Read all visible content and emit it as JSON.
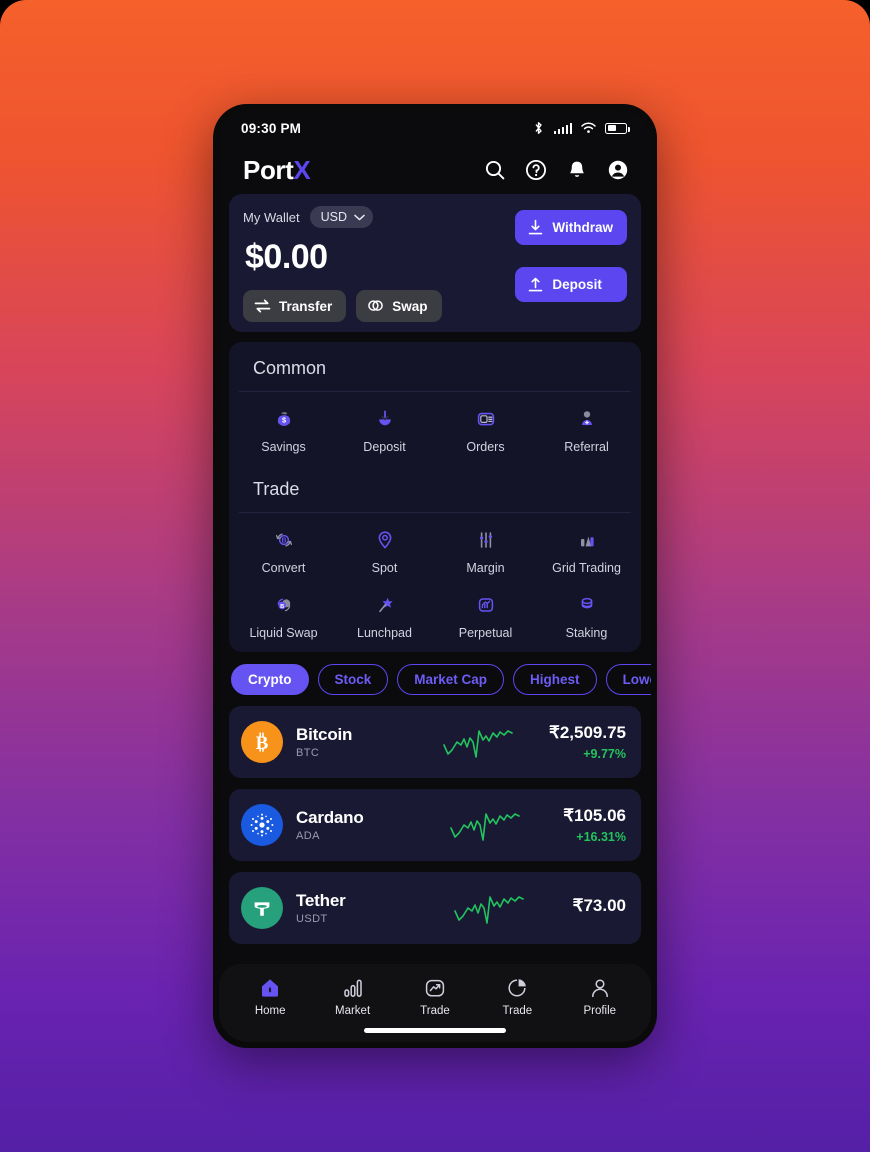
{
  "status_bar": {
    "time": "09:30 PM",
    "icons": [
      "bluetooth-icon",
      "signal-icon",
      "wifi-icon",
      "battery-icon"
    ]
  },
  "header": {
    "brand_first": "Port",
    "brand_accent": "X",
    "icons": [
      "search-icon",
      "help-icon",
      "notification-icon",
      "account-icon"
    ]
  },
  "wallet": {
    "label": "My Wallet",
    "currency": "USD",
    "balance": "$0.00",
    "withdraw_label": "Withdraw",
    "deposit_label": "Deposit",
    "transfer_label": "Transfer",
    "swap_label": "Swap"
  },
  "common": {
    "title": "Common",
    "items": [
      {
        "label": "Savings",
        "icon": "savings-bag-icon"
      },
      {
        "label": "Deposit",
        "icon": "deposit-arrow-icon"
      },
      {
        "label": "Orders",
        "icon": "orders-card-icon"
      },
      {
        "label": "Referral",
        "icon": "referral-person-icon"
      }
    ]
  },
  "trade": {
    "title": "Trade",
    "items": [
      {
        "label": "Convert",
        "icon": "convert-bitcoin-icon"
      },
      {
        "label": "Spot",
        "icon": "spot-pin-icon"
      },
      {
        "label": "Margin",
        "icon": "margin-sliders-icon"
      },
      {
        "label": "Grid\nTrading",
        "icon": "grid-bars-icon"
      },
      {
        "label": "Liquid\nSwap",
        "icon": "liquid-swap-icon"
      },
      {
        "label": "Lunchpad",
        "icon": "lunchpad-star-icon"
      },
      {
        "label": "Perpetual",
        "icon": "perpetual-chart-icon"
      },
      {
        "label": "Staking",
        "icon": "staking-coins-icon"
      }
    ]
  },
  "filters": [
    {
      "label": "Crypto",
      "active": true
    },
    {
      "label": "Stock",
      "active": false
    },
    {
      "label": "Market Cap",
      "active": false
    },
    {
      "label": "Highest",
      "active": false
    },
    {
      "label": "Lowest",
      "active": false
    }
  ],
  "coins": [
    {
      "name": "Bitcoin",
      "symbol": "BTC",
      "price": "₹2,509.75",
      "change": "+9.77%",
      "change_color": "#22C45E",
      "logo_bg": "#F7931A",
      "glyph": "₿",
      "spark_color": "#22C45E"
    },
    {
      "name": "Cardano",
      "symbol": "ADA",
      "price": "₹105.06",
      "change": "+16.31%",
      "change_color": "#22C45E",
      "logo_bg": "#1A5AE0",
      "glyph": "⁙",
      "spark_color": "#22C45E"
    },
    {
      "name": "Tether",
      "symbol": "USDT",
      "price": "₹73.00",
      "change": "",
      "change_color": "#22C45E",
      "logo_bg": "#26A17B",
      "glyph": "₮",
      "spark_color": "#22C45E"
    }
  ],
  "tabbar": [
    {
      "label": "Home",
      "icon": "home-icon",
      "active": true
    },
    {
      "label": "Market",
      "icon": "market-bars-icon",
      "active": false
    },
    {
      "label": "Trade",
      "icon": "trade-chart-icon",
      "active": false
    },
    {
      "label": "Trade",
      "icon": "pie-chart-icon",
      "active": false
    },
    {
      "label": "Profile",
      "icon": "profile-person-icon",
      "active": false
    }
  ],
  "colors": {
    "accent": "#5B46F0",
    "chip_active": "#6553F2",
    "card_bg": "#191933",
    "panel_bg": "#141428",
    "screen_bg": "#0b0b0e",
    "positive": "#22C45E",
    "gradient_top": "#F5602B",
    "gradient_bottom": "#5420A6"
  }
}
